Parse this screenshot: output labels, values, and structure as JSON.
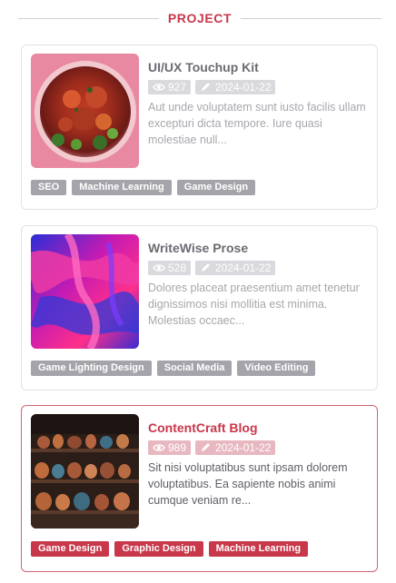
{
  "section": {
    "title": "PROJECT"
  },
  "colors": {
    "accent": "#c8374a",
    "muted_text": "#a7a7ad",
    "tag_gray": "#a4a4aa",
    "meta_gray": "#d9d9de",
    "meta_pink": "#e8b8c1"
  },
  "cards": [
    {
      "title": "UI/UX Touchup Kit",
      "views": "927",
      "date": "2024-01-22",
      "description": "Aut unde voluptatem sunt iusto facilis ullam excepturi dicta tempore. Iure quasi molestiae null...",
      "tags": [
        "SEO",
        "Machine Learning",
        "Game Design"
      ],
      "active": false,
      "image_icon": "food-photo"
    },
    {
      "title": "WriteWise Prose",
      "views": "528",
      "date": "2024-01-22",
      "description": "Dolores placeat praesentium amet tenetur dignissimos nisi mollitia est minima. Molestias occaec...",
      "tags": [
        "Game Lighting Design",
        "Social Media",
        "Video Editing"
      ],
      "active": false,
      "image_icon": "abstract-paint-photo"
    },
    {
      "title": "ContentCraft Blog",
      "views": "989",
      "date": "2024-01-22",
      "description": "Sit nisi voluptatibus sunt ipsam dolorem voluptatibus. Ea sapiente nobis animi cumque veniam re...",
      "tags": [
        "Game Design",
        "Graphic Design",
        "Machine Learning"
      ],
      "active": true,
      "image_icon": "pottery-shelf-photo"
    }
  ]
}
